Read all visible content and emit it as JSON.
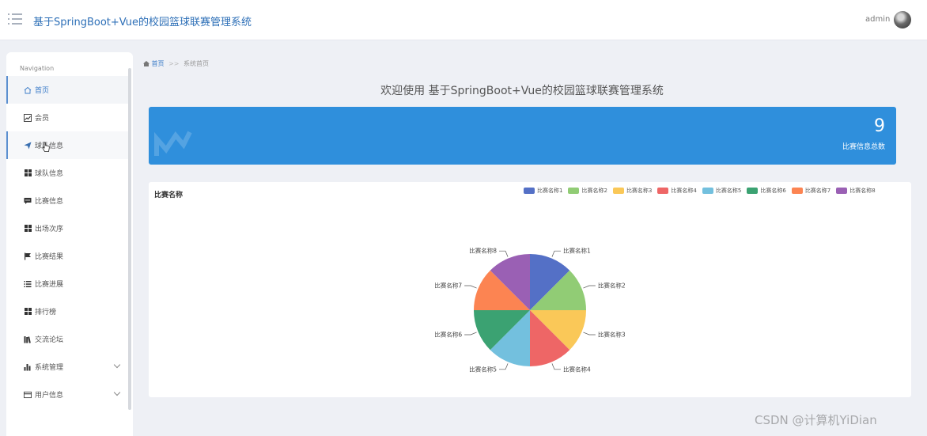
{
  "header": {
    "title": "基于SpringBoot+Vue的校园篮球联赛管理系统",
    "user": "admin"
  },
  "sidebar": {
    "heading": "Navigation",
    "items": [
      {
        "label": "首页",
        "icon": "home-icon"
      },
      {
        "label": "会员",
        "icon": "chart-line-icon"
      },
      {
        "label": "球队信息",
        "icon": "send-icon"
      },
      {
        "label": "球队信息",
        "icon": "grid-icon"
      },
      {
        "label": "比赛信息",
        "icon": "comment-icon"
      },
      {
        "label": "出场次序",
        "icon": "grid-icon"
      },
      {
        "label": "比赛结果",
        "icon": "flag-icon"
      },
      {
        "label": "比赛进展",
        "icon": "list-icon"
      },
      {
        "label": "排行榜",
        "icon": "grid-icon"
      },
      {
        "label": "交流论坛",
        "icon": "library-icon"
      },
      {
        "label": "系统管理",
        "icon": "bar-chart-icon"
      },
      {
        "label": "用户信息",
        "icon": "card-icon"
      }
    ]
  },
  "breadcrumb": {
    "home": "首页",
    "separator": ">>",
    "current": "系统首页"
  },
  "welcome": "欢迎使用 基于SpringBoot+Vue的校园篮球联赛管理系统",
  "stat": {
    "value": "9",
    "label": "比赛信息总数"
  },
  "chart_data": {
    "type": "pie",
    "title": "比赛名称",
    "legend_position": "top-right",
    "categories": [
      "比赛名称1",
      "比赛名称2",
      "比赛名称3",
      "比赛名称4",
      "比赛名称5",
      "比赛名称6",
      "比赛名称7",
      "比赛名称8"
    ],
    "values": [
      1,
      1,
      1,
      1,
      1,
      1,
      1,
      1
    ],
    "colors": [
      "#5470c6",
      "#91cc75",
      "#fac858",
      "#ee6666",
      "#73c0de",
      "#3ba272",
      "#fc8452",
      "#9a60b4"
    ]
  },
  "watermark": "CSDN @计算机YiDian"
}
